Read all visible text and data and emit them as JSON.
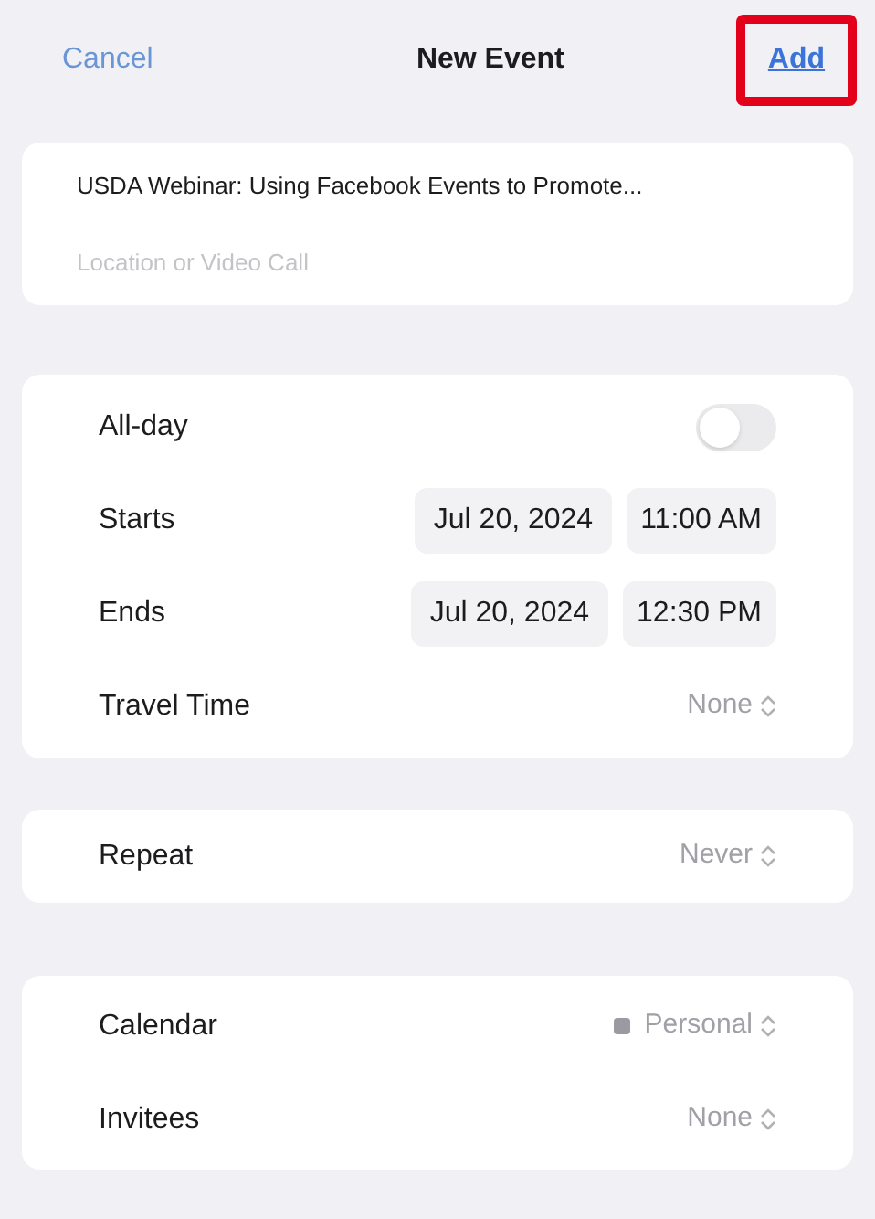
{
  "nav": {
    "cancel": "Cancel",
    "title": "New Event",
    "add": {
      "label": "Add",
      "highlighted": true
    }
  },
  "details": {
    "title": "USDA Webinar: Using Facebook Events to Promote...",
    "location_placeholder": "Location or Video Call"
  },
  "time": {
    "all_day": {
      "label": "All-day",
      "on": false
    },
    "rows": [
      {
        "label": "Starts",
        "date": "Jul 20, 2024",
        "time": "11:00 AM"
      },
      {
        "label": "Ends",
        "date": "Jul 20, 2024",
        "time": "12:30 PM"
      }
    ],
    "travel": {
      "label": "Travel Time",
      "value": "None"
    }
  },
  "repeat": {
    "label": "Repeat",
    "value": "Never"
  },
  "calendar": {
    "label": "Calendar",
    "value": "Personal",
    "color": "#9a9aa0"
  },
  "invitees": {
    "label": "Invitees",
    "value": "None"
  }
}
